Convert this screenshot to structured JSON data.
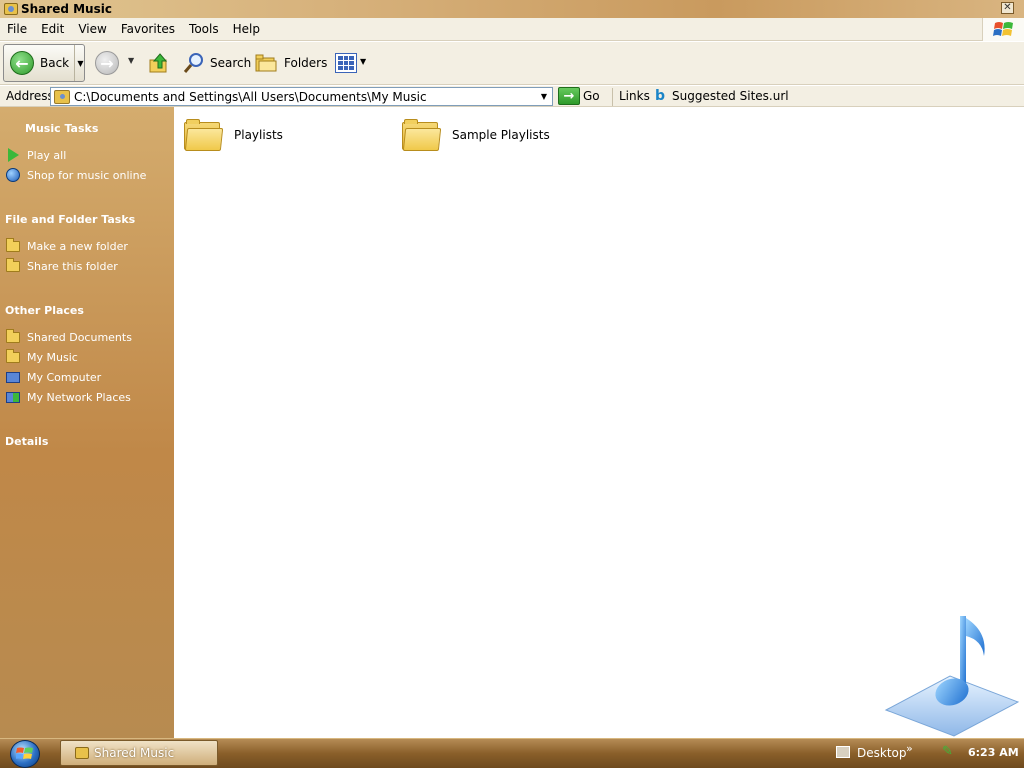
{
  "window": {
    "title": "Shared Music"
  },
  "menu": [
    "File",
    "Edit",
    "View",
    "Favorites",
    "Tools",
    "Help"
  ],
  "toolbar": {
    "back_label": "Back",
    "search_label": "Search",
    "folders_label": "Folders"
  },
  "address": {
    "label": "Address",
    "path": "C:\\Documents and Settings\\All Users\\Documents\\My Music",
    "go_label": "Go",
    "links_label": "Links",
    "link_item": "Suggested Sites.url"
  },
  "sidebar": {
    "music_tasks": {
      "title": "Music Tasks",
      "items": [
        "Play all",
        "Shop for music online"
      ]
    },
    "file_tasks": {
      "title": "File and Folder Tasks",
      "items": [
        "Make a new folder",
        "Share this folder"
      ]
    },
    "other_places": {
      "title": "Other Places",
      "items": [
        "Shared Documents",
        "My Music",
        "My Computer",
        "My Network Places"
      ]
    },
    "details": {
      "title": "Details"
    }
  },
  "content": {
    "items": [
      "Playlists",
      "Sample Playlists"
    ]
  },
  "taskbar": {
    "task_label": "Shared Music",
    "desktop_label": "Desktop",
    "clock": "6:23 AM"
  }
}
